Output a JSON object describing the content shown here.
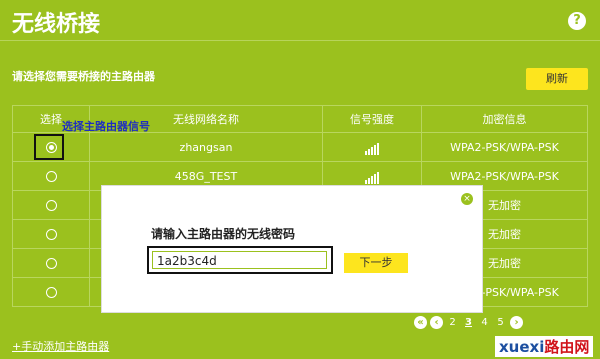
{
  "header": {
    "title": "无线桥接",
    "help_icon": "?"
  },
  "prompt": "请选择您需要桥接的主路由器",
  "refresh_label": "刷新",
  "table": {
    "columns": [
      "选择",
      "无线网络名称",
      "信号强度",
      "加密信息"
    ],
    "rows": [
      {
        "selected": true,
        "ssid": "zhangsan",
        "signal_bars": 5,
        "security": "WPA2-PSK/WPA-PSK"
      },
      {
        "selected": false,
        "ssid": "458G_TEST",
        "signal_bars": 5,
        "security": "WPA2-PSK/WPA-PSK"
      },
      {
        "selected": false,
        "ssid": "",
        "signal_bars": 0,
        "security": "无加密"
      },
      {
        "selected": false,
        "ssid": "",
        "signal_bars": 0,
        "security": "无加密"
      },
      {
        "selected": false,
        "ssid": "",
        "signal_bars": 0,
        "security": "无加密"
      },
      {
        "selected": false,
        "ssid": "",
        "signal_bars": 0,
        "security": "WPA2-PSK/WPA-PSK"
      }
    ]
  },
  "annotation": "选择主路由器信号",
  "modal": {
    "title": "请输入主路由器的无线密码",
    "password_value": "1a2b3c4d",
    "next_label": "下一步",
    "close_icon": "×"
  },
  "add_link": "+手动添加主路由器",
  "pager": {
    "pages": [
      "2",
      "3",
      "4",
      "5"
    ],
    "current": "3"
  },
  "watermark": {
    "part1": "xuexi",
    "part2": "路由网"
  }
}
